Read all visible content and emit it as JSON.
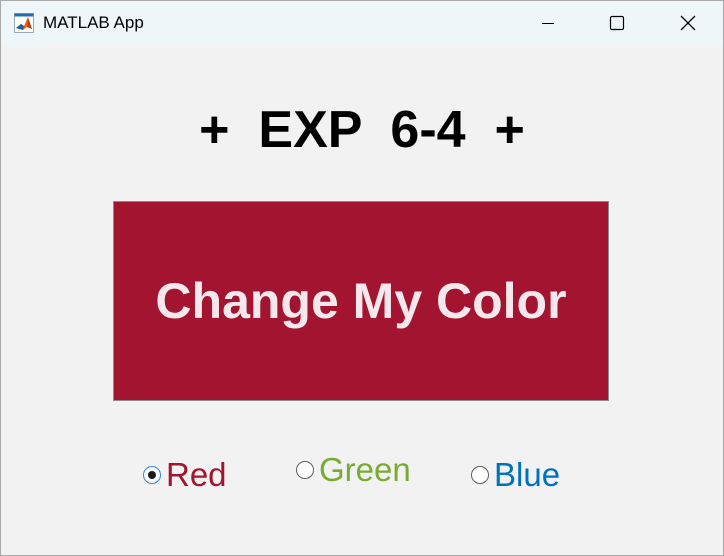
{
  "window": {
    "title": "MATLAB App",
    "controls": {
      "minimize_icon": "minimize-icon",
      "maximize_icon": "maximize-icon",
      "close_icon": "close-icon"
    }
  },
  "app": {
    "heading": "+  EXP  6-4  +",
    "button": {
      "label": "Change My Color",
      "background": "#a2142f",
      "text_color": "#f4e8ec"
    },
    "radio_group": {
      "selected": "Red",
      "options": [
        {
          "label": "Red",
          "checked": true,
          "color": "#a2142f"
        },
        {
          "label": "Green",
          "checked": false,
          "color": "#77ac30"
        },
        {
          "label": "Blue",
          "checked": false,
          "color": "#0072bd"
        }
      ]
    }
  }
}
